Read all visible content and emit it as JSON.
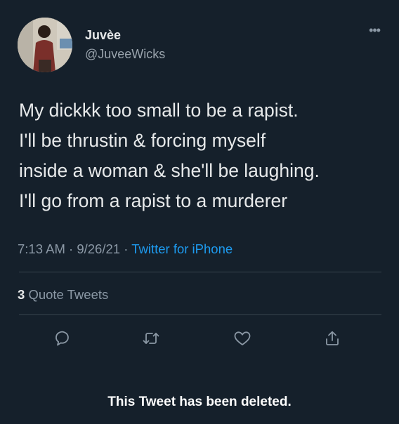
{
  "author": {
    "display_name": "Juvèe",
    "handle": "@JuveeWicks"
  },
  "tweet": {
    "lines": [
      "My dickkk too small to be a rapist.",
      "I'll be thrustin & forcing myself",
      "inside a woman & she'll be laughing.",
      "I'll go from a rapist to a murderer"
    ],
    "time": "7:13 AM",
    "date": "9/26/21",
    "separator": "·",
    "source": "Twitter for iPhone"
  },
  "stats": {
    "quote_count": "3",
    "quote_label": "Quote Tweets"
  },
  "actions": [
    {
      "icon": "reply-icon"
    },
    {
      "icon": "retweet-icon"
    },
    {
      "icon": "like-icon"
    },
    {
      "icon": "share-icon"
    }
  ],
  "notice": {
    "text": "This Tweet has been deleted."
  },
  "colors": {
    "background": "#15202b",
    "text": "#e7e9ea",
    "secondary": "#8b98a5",
    "link": "#1d9bf0",
    "divider": "#38444d"
  }
}
